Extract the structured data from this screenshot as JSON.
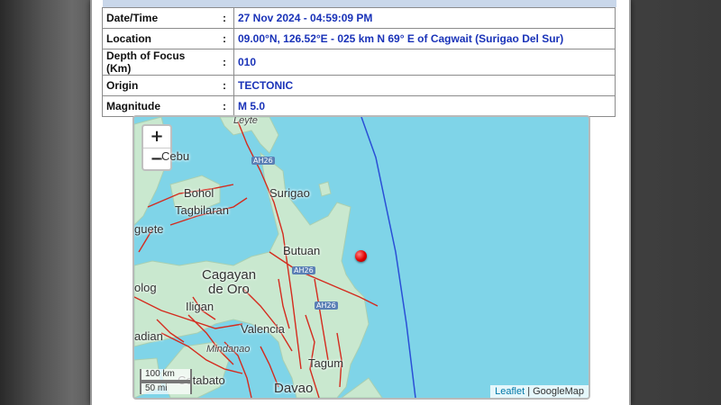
{
  "details": [
    {
      "label": "Date/Time",
      "value": "27 Nov 2024 - 04:59:09 PM"
    },
    {
      "label": "Location",
      "value": "09.00°N, 126.52°E - 025 km N 69° E of Cagwait (Surigao Del Sur)"
    },
    {
      "label": "Depth of Focus (Km)",
      "value": "010"
    },
    {
      "label": "Origin",
      "value": "TECTONIC"
    },
    {
      "label": "Magnitude",
      "value": "M 5.0"
    }
  ],
  "separator": ":",
  "map": {
    "zoom_in": "+",
    "zoom_out": "−",
    "labels": {
      "leyte": "Leyte",
      "cebu": "Cebu",
      "bohol": "Bohol",
      "tagbilaran": "Tagbilaran",
      "guete": "guete",
      "surigao": "Surigao",
      "butuan": "Butuan",
      "cagayan": "Cagayan",
      "de_oro": "de Oro",
      "olog": "olog",
      "iligan": "Iligan",
      "valencia": "Valencia",
      "adian": "adian",
      "mindanao": "Mindanao",
      "tagum": "Tagum",
      "cotabato": "Cotabato",
      "davao": "Davao"
    },
    "roads": [
      "AH26",
      "AH26",
      "AH26"
    ],
    "scale_km": "100 km",
    "scale_mi": "50 mi",
    "attribution_link": "Leaflet",
    "attribution_sep": " | ",
    "attribution_text": "GoogleMap",
    "colors": {
      "sea": "#7fd4e8",
      "land": "#c9e8cf",
      "fault": "#d42b1e",
      "trench": "#2a4fd6",
      "epicenter": "#e00000"
    }
  }
}
